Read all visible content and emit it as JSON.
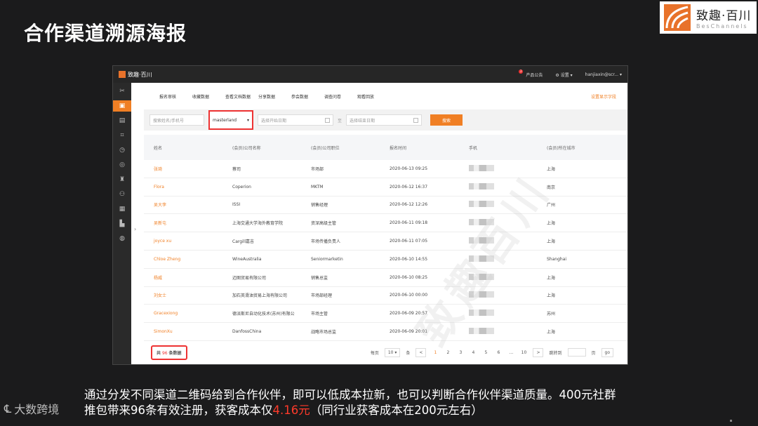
{
  "slide_title": "合作渠道溯源海报",
  "brand": {
    "cn": "致趣·百川",
    "en": "BesChannels"
  },
  "app": {
    "logo_text": "致趣·百川",
    "topbar": {
      "notice_count": "2",
      "notice": "产品公告",
      "settings": "设置",
      "user": "hanjiaxin@scr..."
    },
    "tabs": [
      "报名审核",
      "收藏数据",
      "查看文档数据",
      "分享数据",
      "参会数据",
      "调查问卷",
      "观看回放"
    ],
    "tab_right": "设置显示字段",
    "filters": {
      "search_placeholder": "搜索姓名/手机号",
      "channel_value": "masterland",
      "start_placeholder": "选择开始日期",
      "separator": "至",
      "end_placeholder": "选择结束日期",
      "search_button": "搜索"
    },
    "columns": [
      "姓名",
      "(会员)公司名称",
      "(会员)公司职位",
      "报名时间",
      "手机",
      "(会员)所在城市"
    ],
    "rows": [
      [
        "张琦",
        "蔡司",
        "市场部",
        "2020-06-13 09:25",
        "上海"
      ],
      [
        "Flora",
        "Coperion",
        "MKTM",
        "2020-06-12 16:37",
        "南京"
      ],
      [
        "吴大李",
        "ISSI",
        "销售经理",
        "2020-06-12 12:26",
        "广州"
      ],
      [
        "吴新屯",
        "上海交通大学海外教育学院",
        "资深高级主管",
        "2020-06-11 09:18",
        "上海"
      ],
      [
        "joyce xu",
        "Cargill嘉吉",
        "市场传播负责人",
        "2020-06-11 07:05",
        "上海"
      ],
      [
        "Chloe Zheng",
        "WineAustralia",
        "Seniormarketin",
        "2020-06-10 14:55",
        "Shanghai"
      ],
      [
        "杨威",
        "迈图贸易有限公司",
        "销售总监",
        "2020-06-10 08:25",
        "上海"
      ],
      [
        "刘女士",
        "加石英滑油贸易上海有限公司",
        "市场部经理",
        "2020-06-10 00:00",
        "上海"
      ],
      [
        "Gracexiong",
        "德派斯尼自动化技术(苏州)有限公",
        "市场主管",
        "2020-06-09 20:57",
        "苏州"
      ],
      [
        "SimonXu",
        "DanfossChina",
        "战略市场总监",
        "2020-06-09 20:01",
        "上海"
      ]
    ],
    "pager": {
      "total_prefix": "共",
      "total_count": "96",
      "total_suffix": "条数据",
      "per_page_label": "每页",
      "per_page_value": "10",
      "per_page_unit": "条",
      "prev": "<",
      "pages": [
        "1",
        "2",
        "3",
        "4",
        "5",
        "6",
        "...",
        "10"
      ],
      "next": ">",
      "goto_label": "跳转到",
      "goto_unit": "页",
      "go": "go"
    }
  },
  "caption": {
    "line1": "通过分发不同渠道二维码给到合作伙伴，即可以低成本拉新，也可以判断合作伙伴渠道质量。400元社群",
    "line2_a": "推包带来96条有效注册，获客成本仅",
    "line2_hl": "4.16元",
    "line2_b": "（同行业获客成本在200元左右）"
  },
  "footer_logo": "大数跨境",
  "accent": "#f07f24",
  "highlight": "#ff3a2a"
}
